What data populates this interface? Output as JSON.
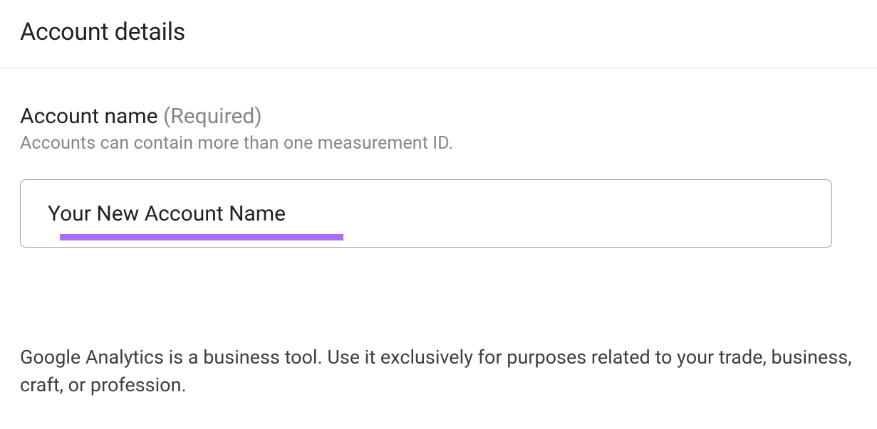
{
  "section": {
    "title": "Account details"
  },
  "form": {
    "accountName": {
      "label": "Account name",
      "requiredText": "(Required)",
      "helper": "Accounts can contain more than one measurement ID.",
      "value": "Your New Account Name"
    }
  },
  "disclaimer": {
    "text": "Google Analytics is a business tool. Use it exclusively for purposes related to your trade, business, craft, or profession."
  }
}
